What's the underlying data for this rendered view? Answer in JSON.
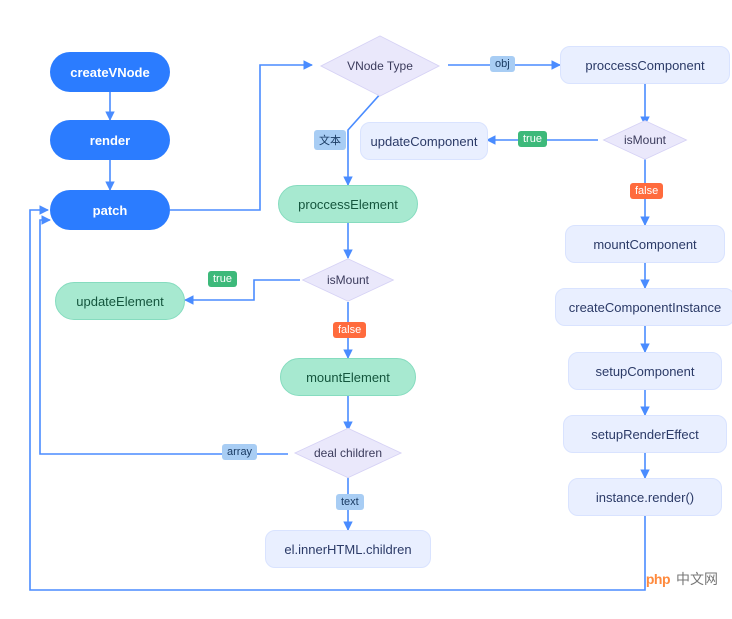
{
  "nodes": {
    "createVNode": "createVNode",
    "render": "render",
    "patch": "patch",
    "vnodeType": "VNode Type",
    "processComponent": "proccessComponent",
    "isMount_c": "isMount",
    "updateComponent": "updateComponent",
    "mountComponent": "mountComponent",
    "createComponentInstance": "createComponentInstance",
    "setupComponent": "setupComponent",
    "setupRenderEffect": "setupRenderEffect",
    "instanceRender": "instance.render()",
    "processElement": "proccessElement",
    "isMount_e": "isMount",
    "updateElement": "updateElement",
    "mountElement": "mountElement",
    "dealChildren": "deal children",
    "innerHTML": "el.innerHTML.children"
  },
  "labels": {
    "obj": "obj",
    "text_cn": "文本",
    "true1": "true",
    "false1": "false",
    "true2": "true",
    "false2": "false",
    "array": "array",
    "text_en": "text"
  },
  "watermark": {
    "php": "php",
    "cn": "中文网"
  },
  "chart_data": {
    "type": "flowchart",
    "title": "",
    "nodes": [
      {
        "id": "createVNode",
        "label": "createVNode",
        "shape": "pill",
        "color": "blue"
      },
      {
        "id": "render",
        "label": "render",
        "shape": "pill",
        "color": "blue"
      },
      {
        "id": "patch",
        "label": "patch",
        "shape": "pill",
        "color": "blue"
      },
      {
        "id": "vnodeType",
        "label": "VNode Type",
        "shape": "diamond"
      },
      {
        "id": "processComponent",
        "label": "proccessComponent",
        "shape": "rect"
      },
      {
        "id": "isMount_c",
        "label": "isMount",
        "shape": "diamond"
      },
      {
        "id": "updateComponent",
        "label": "updateComponent",
        "shape": "rect"
      },
      {
        "id": "mountComponent",
        "label": "mountComponent",
        "shape": "rect"
      },
      {
        "id": "createComponentInstance",
        "label": "createComponentInstance",
        "shape": "rect"
      },
      {
        "id": "setupComponent",
        "label": "setupComponent",
        "shape": "rect"
      },
      {
        "id": "setupRenderEffect",
        "label": "setupRenderEffect",
        "shape": "rect"
      },
      {
        "id": "instanceRender",
        "label": "instance.render()",
        "shape": "rect"
      },
      {
        "id": "processElement",
        "label": "proccessElement",
        "shape": "pill",
        "color": "green"
      },
      {
        "id": "isMount_e",
        "label": "isMount",
        "shape": "diamond"
      },
      {
        "id": "updateElement",
        "label": "updateElement",
        "shape": "pill",
        "color": "green"
      },
      {
        "id": "mountElement",
        "label": "mountElement",
        "shape": "pill",
        "color": "green"
      },
      {
        "id": "dealChildren",
        "label": "deal children",
        "shape": "diamond"
      },
      {
        "id": "innerHTML",
        "label": "el.innerHTML.children",
        "shape": "rect"
      }
    ],
    "edges": [
      {
        "from": "createVNode",
        "to": "render"
      },
      {
        "from": "render",
        "to": "patch"
      },
      {
        "from": "patch",
        "to": "vnodeType"
      },
      {
        "from": "vnodeType",
        "to": "processComponent",
        "label": "obj"
      },
      {
        "from": "vnodeType",
        "to": "processElement",
        "label": "文本"
      },
      {
        "from": "processComponent",
        "to": "isMount_c"
      },
      {
        "from": "isMount_c",
        "to": "updateComponent",
        "label": "true"
      },
      {
        "from": "isMount_c",
        "to": "mountComponent",
        "label": "false"
      },
      {
        "from": "mountComponent",
        "to": "createComponentInstance"
      },
      {
        "from": "createComponentInstance",
        "to": "setupComponent"
      },
      {
        "from": "setupComponent",
        "to": "setupRenderEffect"
      },
      {
        "from": "setupRenderEffect",
        "to": "instanceRender"
      },
      {
        "from": "instanceRender",
        "to": "patch"
      },
      {
        "from": "processElement",
        "to": "isMount_e"
      },
      {
        "from": "isMount_e",
        "to": "updateElement",
        "label": "true"
      },
      {
        "from": "isMount_e",
        "to": "mountElement",
        "label": "false"
      },
      {
        "from": "mountElement",
        "to": "dealChildren"
      },
      {
        "from": "dealChildren",
        "to": "innerHTML",
        "label": "text"
      },
      {
        "from": "dealChildren",
        "to": "patch",
        "label": "array"
      }
    ]
  }
}
